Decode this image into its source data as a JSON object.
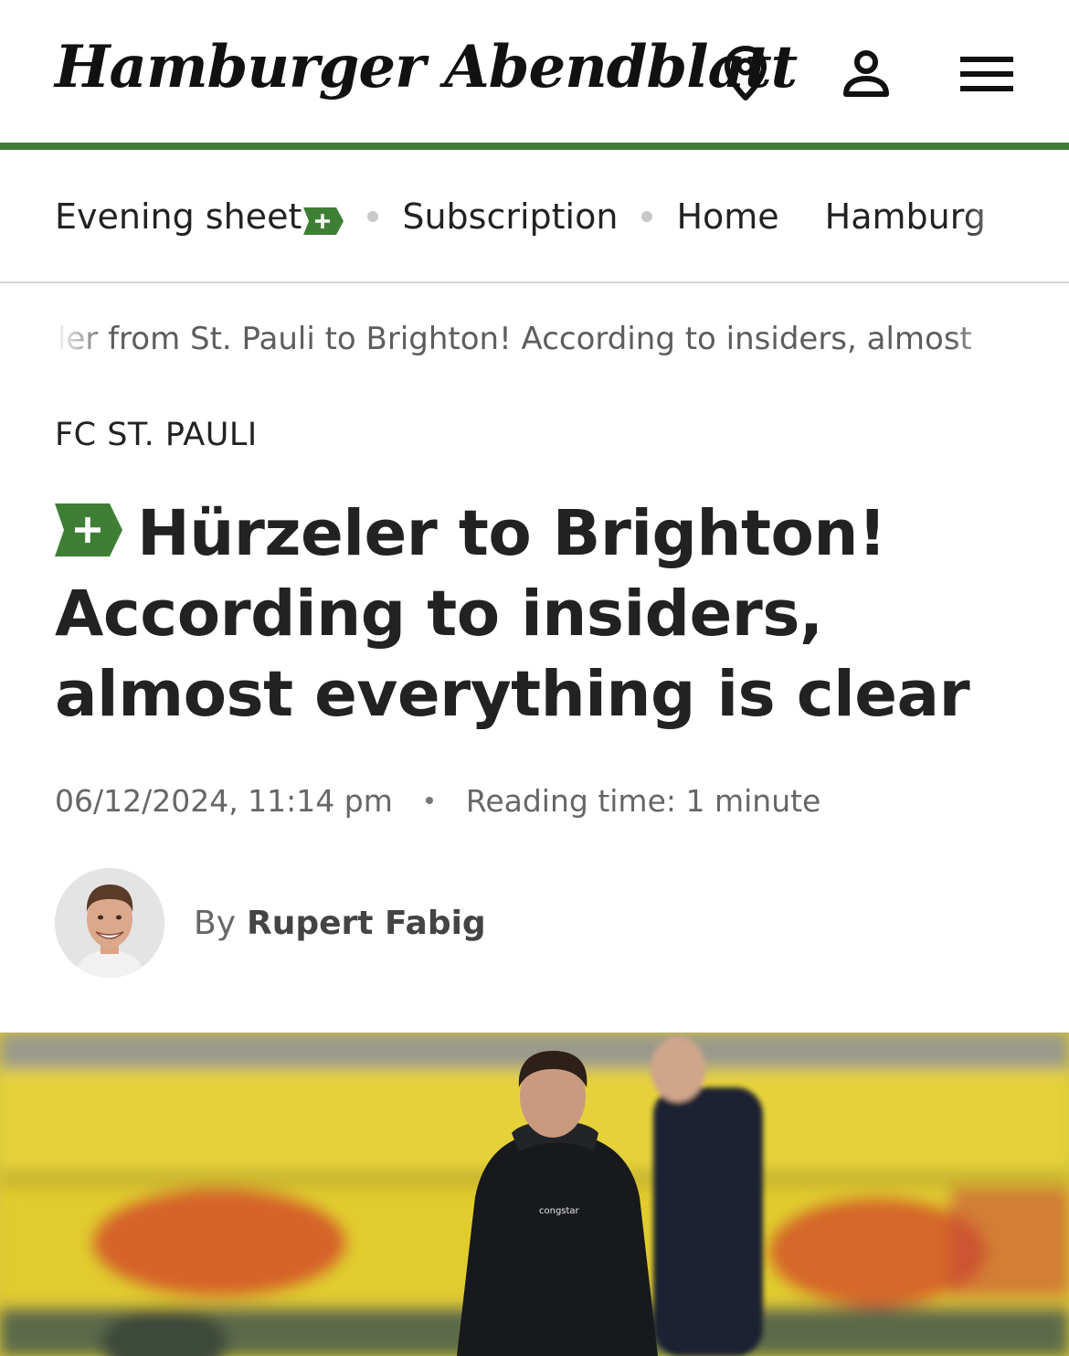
{
  "header": {
    "logo_text": "Hamburger Abendblatt",
    "icons": [
      "location-pin-icon",
      "user-icon",
      "menu-icon"
    ],
    "accent_color": "#3e7f35"
  },
  "nav": {
    "items": [
      {
        "label": "Evening sheet",
        "badge": "+"
      },
      {
        "label": "Subscription"
      },
      {
        "label": "Home"
      },
      {
        "label": "Hamburg"
      }
    ]
  },
  "ticker": {
    "text": "eler from St. Pauli to Brighton! According to insiders, almost"
  },
  "article": {
    "kicker": "FC ST. PAULI",
    "premium_badge": "+",
    "headline": "Hürzeler to Brighton! According to insiders, almost everything is clear",
    "date": "06/12/2024, 11:14 pm",
    "reading_time": "Reading time: 1 minute",
    "author_prefix": "By",
    "author_name": "Rupert Fabig"
  }
}
